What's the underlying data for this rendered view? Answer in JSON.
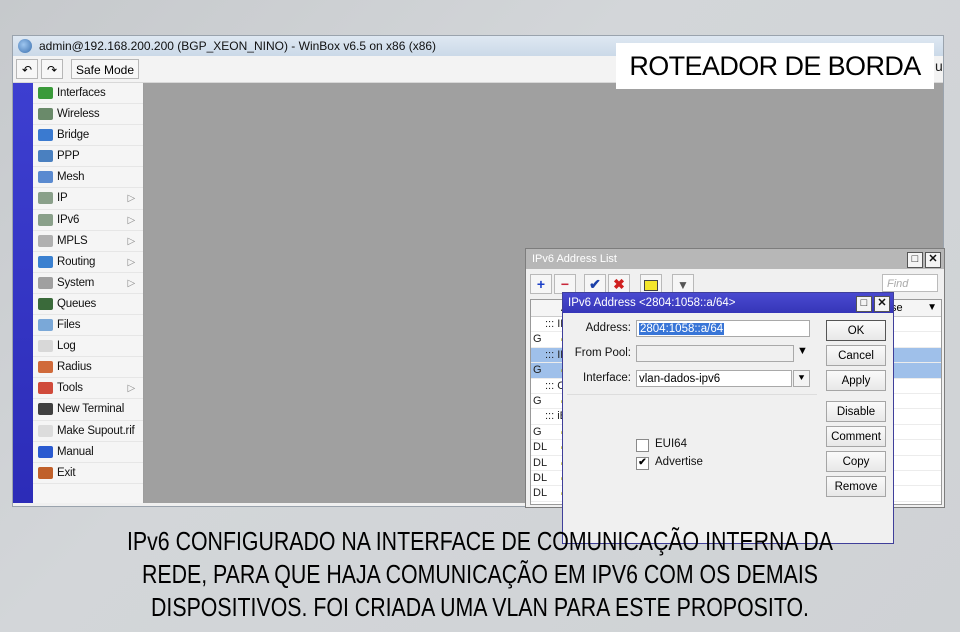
{
  "window": {
    "title": "admin@192.168.200.200 (BGP_XEON_NINO) - WinBox v6.5 on x86 (x86)",
    "toolbar": {
      "undo_icon": "undo-icon",
      "redo_icon": "redo-icon",
      "safe_mode_label": "Safe Mode"
    }
  },
  "sidebar": {
    "items": [
      {
        "label": "Interfaces",
        "icon": "interfaces-icon",
        "submenu": false,
        "color": "#3a9a3a"
      },
      {
        "label": "Wireless",
        "icon": "wireless-icon",
        "submenu": false,
        "color": "#6a8a6a"
      },
      {
        "label": "Bridge",
        "icon": "bridge-icon",
        "submenu": false,
        "color": "#3a7ad0"
      },
      {
        "label": "PPP",
        "icon": "ppp-icon",
        "submenu": false,
        "color": "#4a80c0"
      },
      {
        "label": "Mesh",
        "icon": "mesh-icon",
        "submenu": false,
        "color": "#5a8ad0"
      },
      {
        "label": "IP",
        "icon": "ip-icon",
        "submenu": true,
        "color": "#8aa08a"
      },
      {
        "label": "IPv6",
        "icon": "ipv6-icon",
        "submenu": true,
        "color": "#8aa08a"
      },
      {
        "label": "MPLS",
        "icon": "mpls-icon",
        "submenu": true,
        "color": "#b0b0b0"
      },
      {
        "label": "Routing",
        "icon": "routing-icon",
        "submenu": true,
        "color": "#3a80d0"
      },
      {
        "label": "System",
        "icon": "system-icon",
        "submenu": true,
        "color": "#a0a0a0"
      },
      {
        "label": "Queues",
        "icon": "queues-icon",
        "submenu": false,
        "color": "#3a6a3a"
      },
      {
        "label": "Files",
        "icon": "files-icon",
        "submenu": false,
        "color": "#7aa8d8"
      },
      {
        "label": "Log",
        "icon": "log-icon",
        "submenu": false,
        "color": "#d8d8d8"
      },
      {
        "label": "Radius",
        "icon": "radius-icon",
        "submenu": false,
        "color": "#d06a3a"
      },
      {
        "label": "Tools",
        "icon": "tools-icon",
        "submenu": true,
        "color": "#d04a3a"
      },
      {
        "label": "New Terminal",
        "icon": "terminal-icon",
        "submenu": false,
        "color": "#404040"
      },
      {
        "label": "Make Supout.rif",
        "icon": "supout-icon",
        "submenu": false,
        "color": "#dcdcdc"
      },
      {
        "label": "Manual",
        "icon": "manual-icon",
        "submenu": false,
        "color": "#2a5ad0"
      },
      {
        "label": "Exit",
        "icon": "exit-icon",
        "submenu": false,
        "color": "#c0602a"
      }
    ]
  },
  "address_list": {
    "title": "IPv6 Address List",
    "find_placeholder": "Find",
    "column_header_partial": "Ad",
    "column_header_right_partial": "se",
    "rows": [
      {
        "flag": "",
        "text": "::: IP V",
        "selected": false,
        "comment": true
      },
      {
        "flag": "G",
        "text": "",
        "selected": false,
        "comment": false
      },
      {
        "flag": "",
        "text": "::: IPV",
        "selected": true,
        "comment": true
      },
      {
        "flag": "G",
        "text": "",
        "selected": true,
        "comment": false
      },
      {
        "flag": "",
        "text": "::: OSI",
        "selected": false,
        "comment": true
      },
      {
        "flag": "G",
        "text": "",
        "selected": false,
        "comment": false
      },
      {
        "flag": "",
        "text": "::: iBG",
        "selected": false,
        "comment": true
      },
      {
        "flag": "G",
        "text": "",
        "selected": false,
        "comment": false
      },
      {
        "flag": "DL",
        "text": "",
        "selected": false,
        "comment": false
      },
      {
        "flag": "DL",
        "text": "",
        "selected": false,
        "comment": false
      },
      {
        "flag": "DL",
        "text": "",
        "selected": false,
        "comment": false
      },
      {
        "flag": "DL",
        "text": "",
        "selected": false,
        "comment": false
      },
      {
        "flag": "DL",
        "text": "",
        "selected": false,
        "comment": false
      }
    ]
  },
  "dialog": {
    "title": "IPv6 Address <2804:1058::a/64>",
    "fields": {
      "address_label": "Address:",
      "address_value": "2804:1058::a/64",
      "from_pool_label": "From Pool:",
      "from_pool_value": "",
      "interface_label": "Interface:",
      "interface_value": "vlan-dados-ipv6"
    },
    "checkboxes": {
      "eui64_label": "EUI64",
      "eui64_checked": false,
      "advertise_label": "Advertise",
      "advertise_checked": true
    },
    "buttons": [
      "OK",
      "Cancel",
      "Apply",
      "Disable",
      "Comment",
      "Copy",
      "Remove"
    ]
  },
  "overlay": {
    "caption": "ROTEADOR DE BORDA",
    "description_lines": [
      "IPv6 CONFIGURADO NA INTERFACE DE COMUNICAÇÃO INTERNA DA",
      "REDE, PARA QUE HAJA COMUNICAÇÃO EM IPV6 COM OS DEMAIS",
      "DISPOSITIVOS. FOI CRIADA UMA VLAN PARA ESTE PROPOSITO."
    ]
  }
}
